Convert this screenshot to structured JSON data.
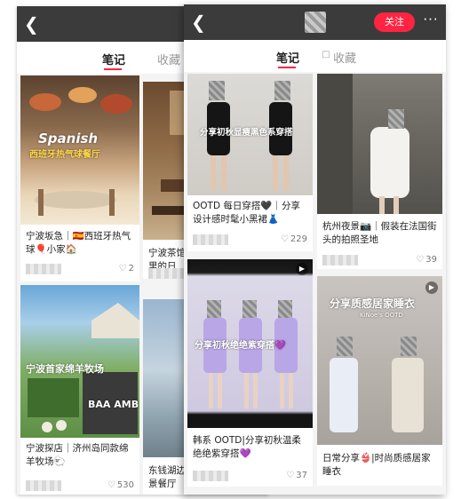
{
  "back_screen": {
    "tabs": {
      "notes": "笔记",
      "collect": "收藏"
    },
    "cards": [
      {
        "title": "宁波坂急｜🇪🇸西班牙热气球🎈小家🏠",
        "likes": "2",
        "overlay_line1": "Spanish",
        "overlay_line2": "西班牙热气球餐厅"
      },
      {
        "title": "宁波茶馆街里的日",
        "likes": ""
      },
      {
        "title": "宁波探店｜济州岛同款绵羊牧场🐑",
        "likes": "530",
        "overlay": "宁波首家绵羊牧场",
        "overlay_sign": "BAA AMB"
      },
      {
        "title": "东钱湖边湖景餐厅",
        "likes": ""
      }
    ]
  },
  "front_screen": {
    "follow_label": "关注",
    "more_icon": "···",
    "tabs": {
      "notes": "笔记",
      "collect": "收藏"
    },
    "cards": [
      {
        "title": "OOTD 每日穿搭🖤｜分享设计感时髦小黑裙👗",
        "likes": "229",
        "overlay": "分享初秋显瘦黑色系穿搭"
      },
      {
        "title": "杭州夜景📷｜假装在法国街头的拍照圣地",
        "likes": "39"
      },
      {
        "title": "韩系 OOTD|分享初秋温柔绝绝紫穿搭💜",
        "likes": "37",
        "overlay": "分享初秋绝绝紫穿搭💜"
      },
      {
        "title": "日常分享👙|时尚质感居家睡衣",
        "likes": "",
        "overlay": "分享质感居家睡衣",
        "overlay_sub": "KiNoe's OOTD"
      }
    ]
  },
  "colors": {
    "accent": "#ff2442",
    "topbar": "#3b3b3b"
  }
}
